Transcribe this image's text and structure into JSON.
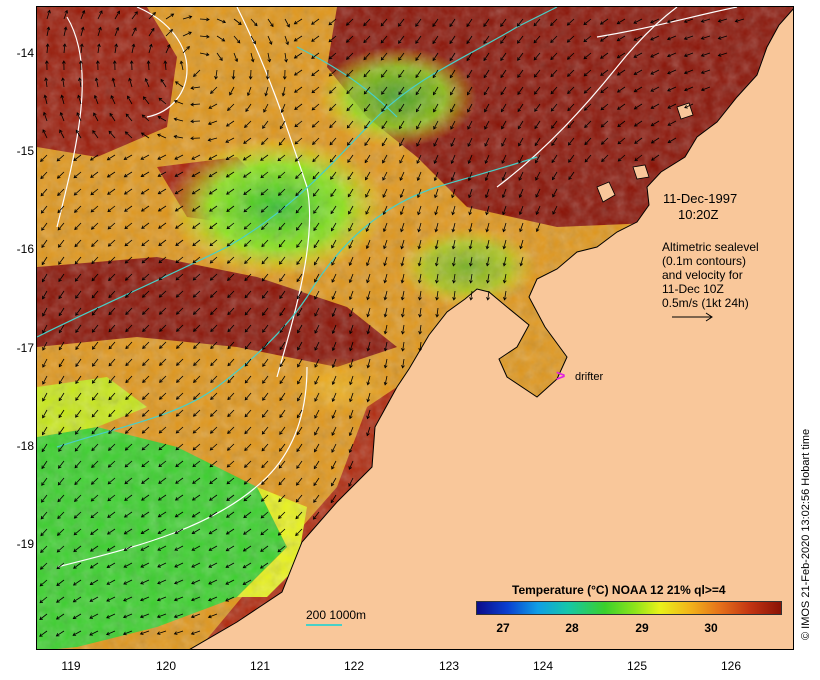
{
  "map": {
    "date": "11-Dec-1997",
    "time": "10:20Z",
    "altimetry_lines": [
      "Altimetric sealevel",
      "(0.1m contours)",
      "and velocity for",
      "11-Dec 10Z",
      "0.5m/s (1kt 24h)"
    ],
    "drifter_label": "drifter",
    "depth_legend": "200  1000m",
    "credit": "© IMOS 21-Feb-2020 13:02:56 Hobart time",
    "axes": {
      "y_ticks": [
        "-14",
        "-15",
        "-16",
        "-17",
        "-18",
        "-19"
      ],
      "x_ticks": [
        "119",
        "120",
        "121",
        "122",
        "123",
        "124",
        "125",
        "126"
      ]
    },
    "legend": {
      "title": "Temperature (°C) NOAA 12 21% ql>=4",
      "ticks": [
        "27",
        "28",
        "29",
        "30"
      ],
      "range": [
        26.6,
        30.7
      ]
    },
    "colors": {
      "land": "#f9c79a",
      "hot": "#8a1306",
      "warm": "#e0961a",
      "mid": "#e8f21a",
      "cool": "#3ad02c",
      "depth_contour": "#48d0c8",
      "sealevel_contour": "#ffffff",
      "drifter": "#e020e0"
    }
  }
}
